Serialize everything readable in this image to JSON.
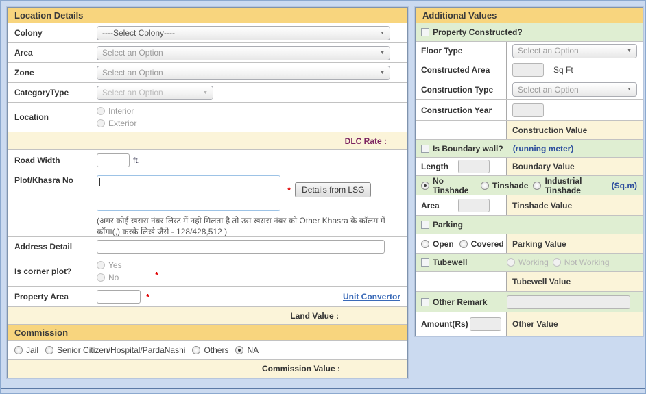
{
  "colors": {
    "page_bg": "#cbdaf0",
    "panel_header_bg": "#f8d57e",
    "yellow_row_bg": "#fbf4d9",
    "green_row_bg": "#dfeed2",
    "link_blue": "#3a6ab8",
    "unit_note_blue": "#2e4f9e",
    "dlc_purple": "#7c2360",
    "required_red": "#e00000"
  },
  "left_panel": {
    "title": "Location Details",
    "colony": {
      "label": "Colony",
      "value": "----Select Colony----"
    },
    "area": {
      "label": "Area",
      "value": "Select an Option"
    },
    "zone": {
      "label": "Zone",
      "value": "Select an Option"
    },
    "category_type": {
      "label": "CategoryType",
      "value": "Select an Option"
    },
    "location": {
      "label": "Location",
      "option1": "Interior",
      "option2": "Exterior"
    },
    "dlc_rate_label": "DLC Rate :",
    "road_width": {
      "label": "Road Width",
      "value": "",
      "unit": "ft."
    },
    "plot_khasra": {
      "label": "Plot/Khasra No",
      "value": "",
      "required_mark": "*",
      "button_label": "Details from LSG",
      "note": "(अगर कोई खसरा नंबर लिस्ट में नही मिलता है तो उस खसरा नंबर को Other Khasra के कॉलम में कॉमा(,) करके लिखे जैसे - 128/428,512 )"
    },
    "address_detail": {
      "label": "Address Detail",
      "value": ""
    },
    "corner_plot": {
      "label": "Is corner plot?",
      "option1": "Yes",
      "option2": "No",
      "required_mark": "*"
    },
    "property_area": {
      "label": "Property Area",
      "value": "",
      "required_mark": "*",
      "link": "Unit Convertor"
    },
    "land_value_label": "Land Value :",
    "commission": {
      "title": "Commission",
      "options": [
        "Jail",
        "Senior Citizen/Hospital/PardaNashi",
        "Others",
        "NA"
      ],
      "selected": "NA"
    },
    "commission_value_label": "Commission Value :"
  },
  "right_panel": {
    "title": "Additional Values",
    "property_constructed": {
      "label": "Property Constructed?",
      "checked": false
    },
    "floor_type": {
      "label": "Floor Type",
      "value": "Select an Option"
    },
    "constructed_area": {
      "label": "Constructed Area",
      "value": "",
      "unit": "Sq Ft"
    },
    "construction_type": {
      "label": "Construction Type",
      "value": "Select an Option"
    },
    "construction_year": {
      "label": "Construction Year",
      "value": ""
    },
    "construction_value_label": "Construction Value",
    "boundary_wall": {
      "label": "Is Boundary wall?",
      "unit_note": "(running meter)",
      "checked": false
    },
    "length": {
      "label": "Length",
      "value": ""
    },
    "boundary_value_label": "Boundary Value",
    "tinshade": {
      "options": [
        "No Tinshade",
        "Tinshade",
        "Industrial Tinshade"
      ],
      "selected": "No Tinshade",
      "unit_note": "(Sq.m)"
    },
    "area": {
      "label": "Area",
      "value": ""
    },
    "tinshade_value_label": "Tinshade Value",
    "parking": {
      "label": "Parking",
      "checked": false,
      "option1": "Open",
      "option2": "Covered"
    },
    "parking_value_label": "Parking Value",
    "tubewell": {
      "label": "Tubewell",
      "checked": false,
      "option1": "Working",
      "option2": "Not Working"
    },
    "tubewell_value_label": "Tubewell Value",
    "other_remark": {
      "label": "Other Remark",
      "checked": false,
      "value": ""
    },
    "amount": {
      "label": "Amount(Rs)",
      "value": ""
    },
    "other_value_label": "Other Value"
  }
}
